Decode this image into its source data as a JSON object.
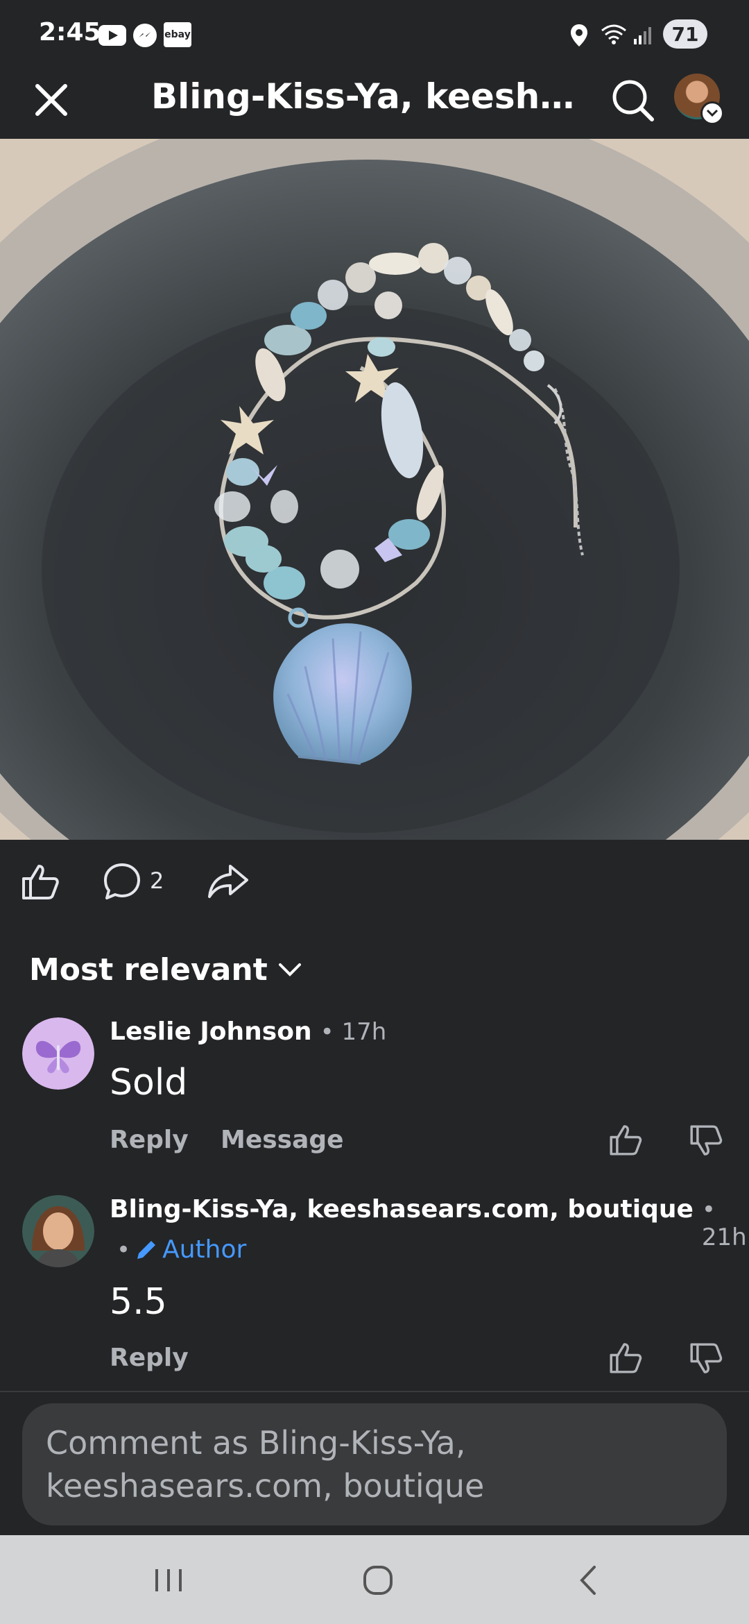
{
  "status_bar": {
    "time": "2:45",
    "ebay_label": "ebay",
    "battery": "71"
  },
  "header": {
    "title": "Bling-Kiss-Ya, keeshase..."
  },
  "actions": {
    "comment_count": "2"
  },
  "sort": {
    "label": "Most relevant"
  },
  "comments": [
    {
      "name": "Leslie Johnson",
      "time": "• 17h",
      "text": "Sold",
      "reply_label": "Reply",
      "message_label": "Message"
    },
    {
      "name": "Bling-Kiss-Ya, keeshasears.com, boutique",
      "time": "• 21h",
      "author_label": "Author",
      "bullet": "•",
      "text": "5.5",
      "reply_label": "Reply"
    }
  ],
  "comment_input": {
    "placeholder": "Comment as Bling-Kiss-Ya, keeshasears.com, boutique"
  },
  "colors": {
    "background": "#242527",
    "author_accent": "#4599ff",
    "nav_bar": "#d3d4d6"
  }
}
